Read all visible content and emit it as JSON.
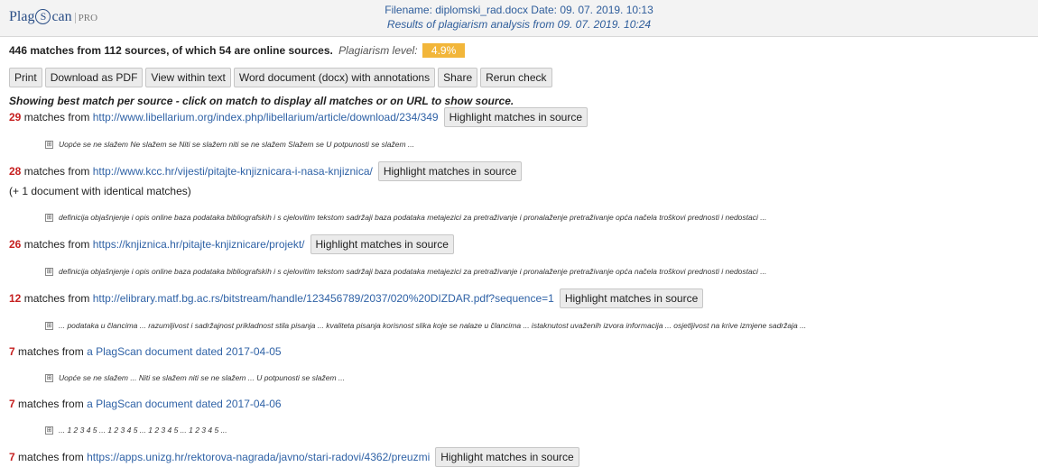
{
  "header": {
    "logo_text": "PlagScan",
    "logo_pro": "PRO",
    "file_line": "Filename: diplomski_rad.docx   Date: 09. 07. 2019. 10:13",
    "results_line": "Results of plagiarism analysis from 09. 07. 2019. 10:24"
  },
  "summary": {
    "text": "446 matches from 112 sources, of which 54 are online sources.",
    "level_label": "Plagiarism level:",
    "level_value": "4.9%"
  },
  "toolbar": [
    "Print",
    "Download as PDF",
    "View within text",
    "Word document (docx) with annotations",
    "Share",
    "Rerun check"
  ],
  "note": "Showing best match per source - click on match to display all matches or on URL to show source.",
  "highlight_label": "Highlight matches in source",
  "matches_from_label": "matches from",
  "expand_glyph": "⊞",
  "sources": [
    {
      "count": "29",
      "link": "http://www.libellarium.org/index.php/libellarium/article/download/234/349",
      "highlight": true,
      "detail": "Uopće se ne slažem Ne slažem se Niti se slažem niti se ne slažem Slažem se U potpunosti se slažem ..."
    },
    {
      "count": "28",
      "link": "http://www.kcc.hr/vijesti/pitajte-knjiznicara-i-nasa-knjiznica/",
      "highlight": true,
      "identical": "(+ 1 document with identical matches)",
      "detail": "definicija objašnjenje i opis online baza podataka bibliografskih i s cjelovitim tekstom sadržaji baza podataka metajezici za pretraživanje i pronalaženje pretraživanje opća načela troškovi prednosti i nedostaci ..."
    },
    {
      "count": "26",
      "link": "https://knjiznica.hr/pitajte-knjiznicare/projekt/",
      "highlight": true,
      "detail": "definicija objašnjenje i opis online baza podataka bibliografskih i s cjelovitim tekstom sadržaji baza podataka metajezici za pretraživanje i pronalaženje pretraživanje opća načela troškovi prednosti i nedostaci ..."
    },
    {
      "count": "12",
      "link": "http://elibrary.matf.bg.ac.rs/bitstream/handle/123456789/2037/020%20DIZDAR.pdf?sequence=1",
      "highlight": true,
      "detail": "... podataka u člancima ... razumljivost i sadržajnost prikladnost stila pisanja ... kvaliteta pisanja korisnost slika koje se nalaze u člancima ... istaknutost uvaženih izvora informacija ... osjetljivost na krive izmjene sadržaja ..."
    },
    {
      "count": "7",
      "link": "a PlagScan document dated 2017-04-05",
      "highlight": false,
      "detail": "Uopće se ne slažem ... Niti se slažem niti se ne slažem ... U potpunosti se slažem ..."
    },
    {
      "count": "7",
      "link": "a PlagScan document dated 2017-04-06",
      "highlight": false,
      "detail": "... 1 2 3 4 5 ... 1 2 3 4 5 ... 1 2 3 4 5 ... 1 2 3 4 5 ..."
    },
    {
      "count": "7",
      "link": "https://apps.unizg.hr/rektorova-nagrada/javno/stari-radovi/4362/preuzmi",
      "highlight": true
    }
  ]
}
